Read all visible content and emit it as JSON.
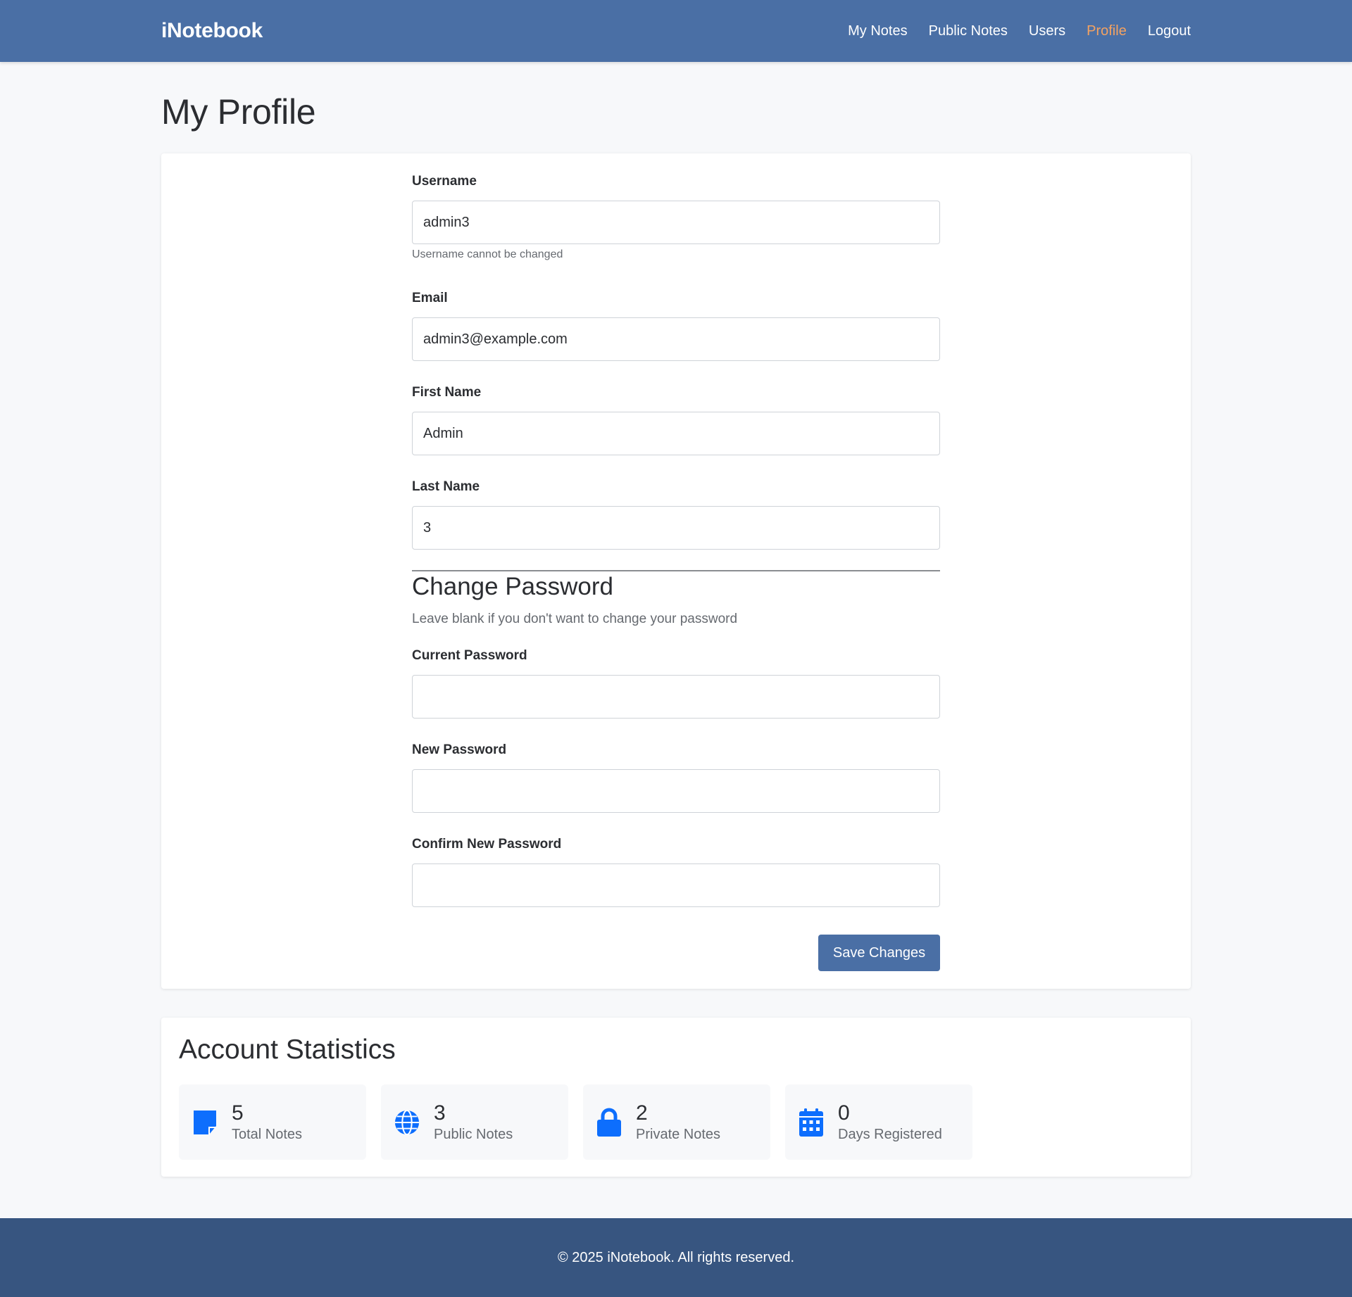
{
  "header": {
    "brand": "iNotebook",
    "nav": [
      {
        "label": "My Notes",
        "active": false
      },
      {
        "label": "Public Notes",
        "active": false
      },
      {
        "label": "Users",
        "active": false
      },
      {
        "label": "Profile",
        "active": true
      },
      {
        "label": "Logout",
        "active": false
      }
    ]
  },
  "page": {
    "title": "My Profile"
  },
  "profile_form": {
    "username": {
      "label": "Username",
      "value": "admin3",
      "hint": "Username cannot be changed"
    },
    "email": {
      "label": "Email",
      "value": "admin3@example.com"
    },
    "first_name": {
      "label": "First Name",
      "value": "Admin"
    },
    "last_name": {
      "label": "Last Name",
      "value": "3"
    },
    "password_section": {
      "title": "Change Password",
      "note": "Leave blank if you don't want to change your password",
      "current_password": {
        "label": "Current Password",
        "value": ""
      },
      "new_password": {
        "label": "New Password",
        "value": ""
      },
      "confirm_password": {
        "label": "Confirm New Password",
        "value": ""
      }
    },
    "save_label": "Save Changes"
  },
  "stats": {
    "title": "Account Statistics",
    "items": [
      {
        "value": "5",
        "label": "Total Notes",
        "icon": "sticky-note-icon"
      },
      {
        "value": "3",
        "label": "Public Notes",
        "icon": "globe-icon"
      },
      {
        "value": "2",
        "label": "Private Notes",
        "icon": "lock-icon"
      },
      {
        "value": "0",
        "label": "Days Registered",
        "icon": "calendar-icon"
      }
    ]
  },
  "footer": {
    "text": "© 2025 iNotebook. All rights reserved."
  },
  "colors": {
    "navbar": "#4a6fa5",
    "active_link": "#f4a261",
    "button": "#4a6fa5",
    "stat_icon": "#0d6efd",
    "footer": "#375580"
  }
}
